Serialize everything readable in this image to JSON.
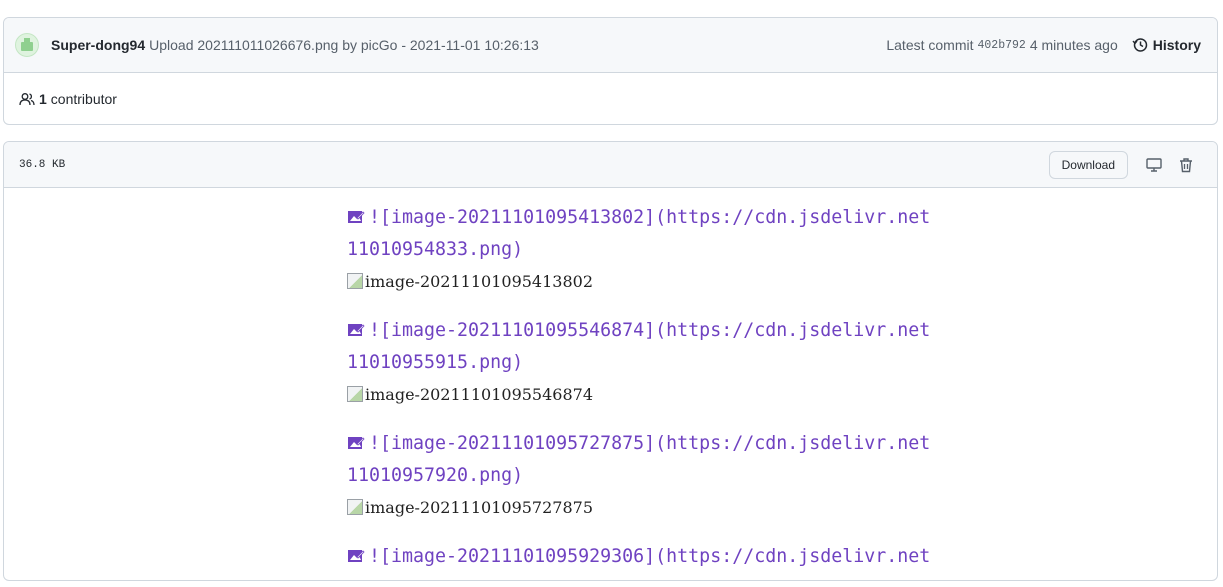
{
  "commit": {
    "author": "Super-dong94",
    "message": "Upload 202111011026676.png by picGo - 2021-11-01 10:26:13",
    "latest_label": "Latest commit",
    "sha": "402b792",
    "time_ago": "4 minutes ago",
    "history_label": "History"
  },
  "contributors": {
    "count": "1",
    "label": "contributor"
  },
  "file": {
    "size": "36.8 KB",
    "download_label": "Download",
    "icons": [
      "desktop-icon",
      "trash-icon"
    ]
  },
  "content": {
    "entries": [
      {
        "line1": "![image-20211101095413802](https://cdn.jsdelivr.net",
        "line2": "11010954833.png)",
        "alt": "image-20211101095413802"
      },
      {
        "line1": "![image-20211101095546874](https://cdn.jsdelivr.net",
        "line2": "11010955915.png)",
        "alt": "image-20211101095546874"
      },
      {
        "line1": "![image-20211101095727875](https://cdn.jsdelivr.net",
        "line2": "11010957920.png)",
        "alt": "image-20211101095727875"
      },
      {
        "line1": "![image-20211101095929306](https://cdn.jsdelivr.net",
        "line2": "",
        "alt": ""
      }
    ]
  },
  "colors": {
    "link_purple": "#6f42c1",
    "border": "#d0d7de",
    "header_bg": "#f6f8fa"
  }
}
